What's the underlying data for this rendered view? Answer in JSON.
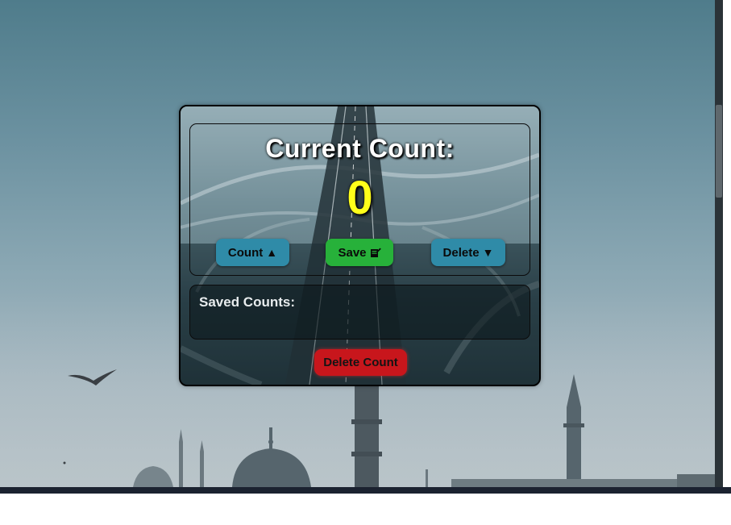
{
  "app": {
    "title": "Current Count:",
    "count_value": "0"
  },
  "buttons": {
    "count": {
      "label": "Count",
      "icon": "triangle-up-icon",
      "color": "#2f8ba8"
    },
    "save": {
      "label": "Save",
      "icon": "note-edit-icon",
      "color": "#27b13a"
    },
    "delete": {
      "label": "Delete",
      "icon": "triangle-down-icon",
      "color": "#2f8ba8"
    },
    "delete_count": {
      "label": "Delete Count",
      "color": "#c8161c"
    }
  },
  "saved": {
    "label": "Saved Counts:",
    "entries": []
  },
  "colors": {
    "count_value": "#ffff1a",
    "title": "#ffffff"
  }
}
